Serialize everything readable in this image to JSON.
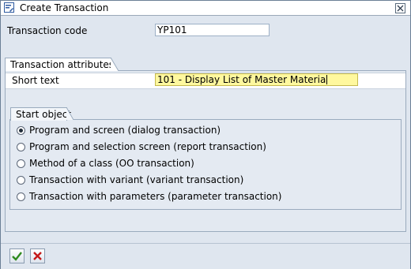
{
  "window": {
    "title": "Create Transaction"
  },
  "form": {
    "transaction_code_label": "Transaction code",
    "transaction_code_value": "YP101"
  },
  "attributes": {
    "group_title": "Transaction attributes",
    "short_text_label": "Short text",
    "short_text_value": "101 - Display List of Master Materia"
  },
  "start_object": {
    "group_title": "Start object",
    "options": [
      {
        "label": "Program and screen (dialog transaction)",
        "selected": true
      },
      {
        "label": "Program and selection screen (report transaction)",
        "selected": false
      },
      {
        "label": "Method of a class (OO transaction)",
        "selected": false
      },
      {
        "label": "Transaction with variant (variant transaction)",
        "selected": false
      },
      {
        "label": "Transaction with parameters (parameter transaction)",
        "selected": false
      }
    ]
  },
  "icons": {
    "app": "create-transaction-icon",
    "close": "close-icon",
    "confirm": "checkmark-icon",
    "cancel": "cancel-x-icon"
  },
  "colors": {
    "required_field": "#fff89e",
    "confirm_green": "#2f8a1e",
    "cancel_red": "#c41818"
  }
}
